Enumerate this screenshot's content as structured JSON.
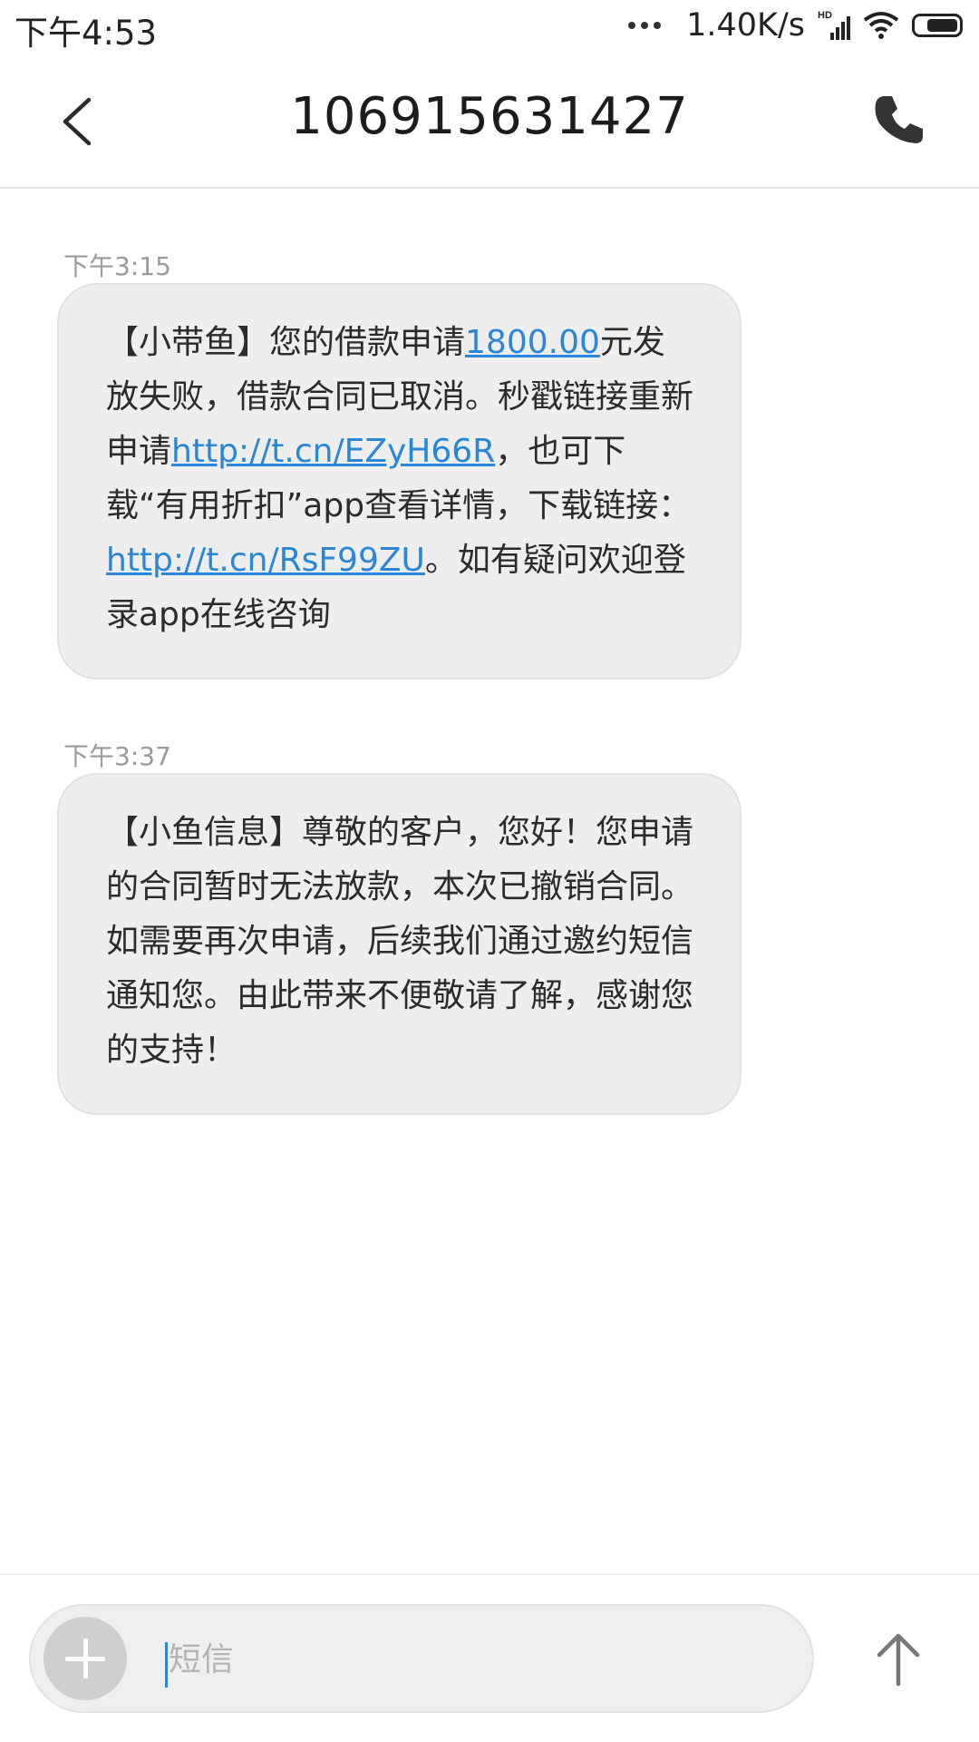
{
  "status_bar": {
    "time": "下午4:53",
    "network_speed": "1.40K/s",
    "network_type": "HD",
    "icons": [
      "more-dots-icon",
      "signal-icon",
      "wifi-icon",
      "battery-icon"
    ]
  },
  "header": {
    "title": "106915631427",
    "back_icon": "chevron-left-icon",
    "call_icon": "phone-icon"
  },
  "messages": [
    {
      "time": "下午3:15",
      "parts": [
        {
          "text": "【小带鱼】您的借款申请"
        },
        {
          "text": "1800.00",
          "link": true
        },
        {
          "text": "元发放失败，借款合同已取消。秒戳链接重新申请"
        },
        {
          "text": "http://t.cn/EZyH66R",
          "link": true
        },
        {
          "text": "，也可下载“有用折扣”app查看详情，下载链接："
        },
        {
          "text": "http://t.cn/RsF99ZU",
          "link": true
        },
        {
          "text": "。如有疑问欢迎登录app在线咨询"
        }
      ]
    },
    {
      "time": "下午3:37",
      "parts": [
        {
          "text": "【小鱼信息】尊敬的客户，您好！您申请的合同暂时无法放款，本次已撤销合同。如需要再次申请，后续我们通过邀约短信通知您。由此带来不便敬请了解，感谢您的支持！"
        }
      ]
    }
  ],
  "composer": {
    "placeholder": "短信",
    "value": "",
    "add_icon": "plus-icon",
    "send_icon": "arrow-up-icon"
  },
  "colors": {
    "link": "#2a86d6",
    "bubble_bg": "#eeeeee",
    "timestamp": "#9a9a9a"
  }
}
